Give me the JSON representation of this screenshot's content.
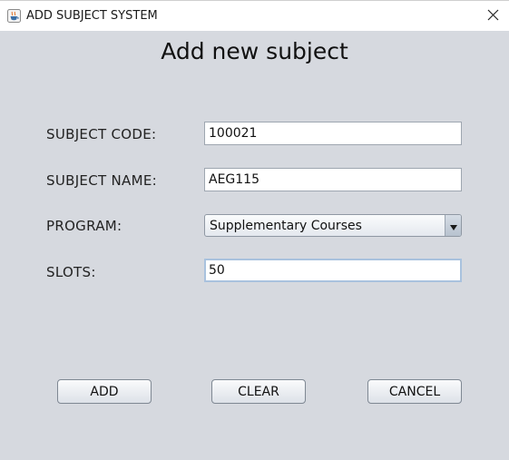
{
  "window": {
    "title": "ADD SUBJECT SYSTEM",
    "app_icon": "java-cup-icon",
    "close_icon": "close-icon"
  },
  "form": {
    "heading": "Add new subject",
    "fields": {
      "subject_code": {
        "label": "SUBJECT CODE:",
        "value": "100021"
      },
      "subject_name": {
        "label": "SUBJECT NAME:",
        "value": "AEG115"
      },
      "program": {
        "label": "PROGRAM:",
        "value": "Supplementary Courses"
      },
      "slots": {
        "label": "SLOTS:",
        "value": "50"
      }
    }
  },
  "buttons": {
    "add": "ADD",
    "clear": "CLEAR",
    "cancel": "CANCEL"
  },
  "colors": {
    "window_bg": "#d6d9df",
    "titlebar_bg": "#ffffff",
    "focus_border": "#a9c2de"
  }
}
